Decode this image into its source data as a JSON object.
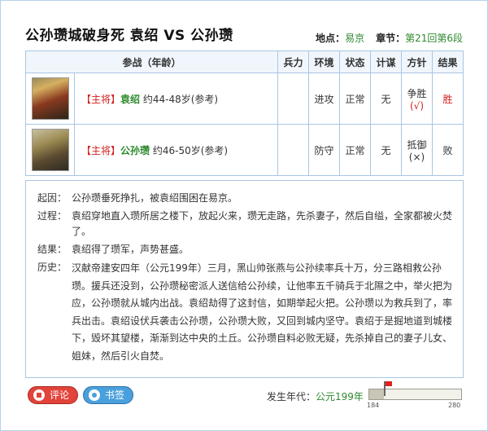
{
  "header": {
    "title": "公孙瓒城破身死 袁绍 VS 公孙瓒",
    "location_label": "地点：",
    "location_value": "易京",
    "chapter_label": "章节：",
    "chapter_value": "第21回第6段"
  },
  "table": {
    "columns": [
      "参战（年龄）",
      "兵力",
      "环境",
      "状态",
      "计谋",
      "方针",
      "结果"
    ],
    "rows": [
      {
        "role": "【主将】",
        "name": "袁绍",
        "age": "约44-48岁(参考)",
        "troops": "",
        "environment": "进攻",
        "status": "正常",
        "strategy": "无",
        "policy": "争胜",
        "policy_mark": "(√)",
        "result": "胜"
      },
      {
        "role": "【主将】",
        "name": "公孙瓒",
        "age": "约46-50岁(参考)",
        "troops": "",
        "environment": "防守",
        "status": "正常",
        "strategy": "无",
        "policy": "抵御",
        "policy_mark": "(×)",
        "result": "败"
      }
    ]
  },
  "story": {
    "cause_label": "起因：",
    "cause": "公孙瓒垂死挣扎，被袁绍围困在易京。",
    "process_label": "过程：",
    "process": "袁绍穿地直入瓒所居之楼下，放起火来，瓒无走路，先杀妻子，然后自缢，全家都被火焚了。",
    "result_label": "结果：",
    "result": "袁绍得了瓒军，声势甚盛。",
    "history_label": "历史：",
    "history": "汉献帝建安四年（公元199年）三月，黑山帅张燕与公孙续率兵十万，分三路相救公孙瓒。援兵还没到，公孙瓒秘密派人送信给公孙续，让他率五千骑兵于北隰之中，举火把为应，公孙瓒就从城内出战。袁绍劫得了这封信，如期举起火把。公孙瓒以为救兵到了，率兵出击。袁绍设伏兵袭击公孙瓒，公孙瓒大败，又回到城内坚守。袁绍于是掘地道到城楼下，毁坏其望楼，渐渐到达中央的土丘。公孙瓒自料必败无疑，先杀掉自己的妻子儿女、姐妹，然后引火自焚。"
  },
  "footer": {
    "review_label": "评论",
    "bookmark_label": "书签",
    "era_label": "发生年代：",
    "era_value": "公元199年",
    "timeline_min": "184",
    "timeline_max": "280",
    "timeline_value": 199
  },
  "colors": {
    "border": "#a9c6e3",
    "accent_green": "#2f8a2f",
    "accent_red": "#d42020"
  },
  "icons": [
    "review-icon",
    "bookmark-icon",
    "timeline-flag-icon"
  ]
}
